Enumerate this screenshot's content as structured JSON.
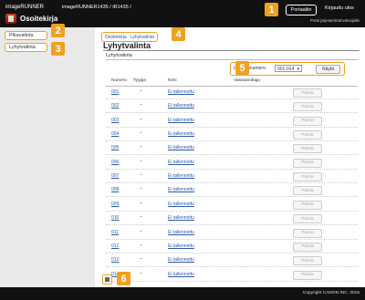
{
  "header": {
    "brand": "imageRUNNER",
    "model": "imageRUNNER1435 / iR1435 /",
    "app_title": "Osoitekirja",
    "portal_label": "Portaaliin",
    "logout_label": "Kirjaudu ulos",
    "mail_link": "Posti järjestelmänvalvojalle"
  },
  "sidebar": {
    "items": [
      {
        "label": "Pikavalinta"
      },
      {
        "label": "Lyhytvalinta"
      }
    ]
  },
  "breadcrumb": "Osoitekirja : Lyhytvalinta",
  "page_title": "Lyhytvalinta",
  "section_title": "Lyhytvalinta",
  "filter": {
    "label": "Luettelonumero:",
    "selected": "001-014",
    "show_label": "Näytä"
  },
  "table": {
    "headers": [
      "Numero",
      "Tyyppi",
      "Nimi",
      "Vastaanottaja"
    ],
    "rows": [
      {
        "num": "001",
        "type": "–",
        "name": "Ei tallennettu",
        "delete": "Poista"
      },
      {
        "num": "002",
        "type": "–",
        "name": "Ei tallennettu",
        "delete": "Poista"
      },
      {
        "num": "003",
        "type": "–",
        "name": "Ei tallennettu",
        "delete": "Poista"
      },
      {
        "num": "004",
        "type": "–",
        "name": "Ei tallennettu",
        "delete": "Poista"
      },
      {
        "num": "005",
        "type": "–",
        "name": "Ei tallennettu",
        "delete": "Poista"
      },
      {
        "num": "006",
        "type": "–",
        "name": "Ei tallennettu",
        "delete": "Poista"
      },
      {
        "num": "007",
        "type": "–",
        "name": "Ei tallennettu",
        "delete": "Poista"
      },
      {
        "num": "008",
        "type": "–",
        "name": "Ei tallennettu",
        "delete": "Poista"
      },
      {
        "num": "009",
        "type": "–",
        "name": "Ei tallennettu",
        "delete": "Poista"
      },
      {
        "num": "010",
        "type": "–",
        "name": "Ei tallennettu",
        "delete": "Poista"
      },
      {
        "num": "011",
        "type": "–",
        "name": "Ei tallennettu",
        "delete": "Poista"
      },
      {
        "num": "012",
        "type": "–",
        "name": "Ei tallennettu",
        "delete": "Poista"
      },
      {
        "num": "013",
        "type": "–",
        "name": "Ei tallennettu",
        "delete": "Poista"
      },
      {
        "num": "014",
        "type": "–",
        "name": "Ei tallennettu",
        "delete": "Poista"
      }
    ]
  },
  "callouts": [
    "1",
    "2",
    "3",
    "4",
    "5",
    "6"
  ],
  "footer": {
    "copyright": "Copyright CANON INC. 2015"
  },
  "colors": {
    "accent": "#f0a020",
    "header_bg": "#111111",
    "link": "#2a5aa8"
  }
}
